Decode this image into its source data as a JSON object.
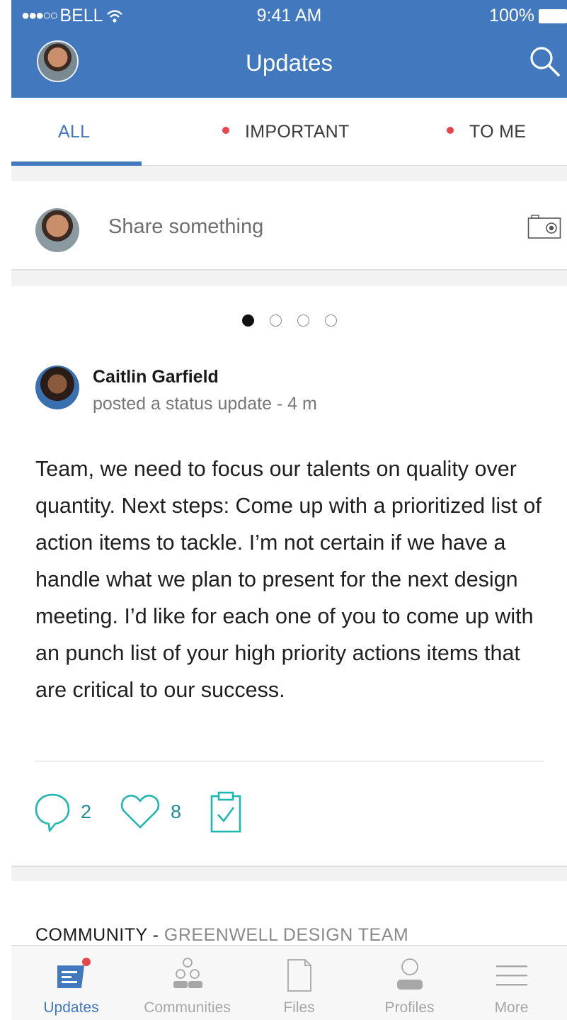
{
  "status_bar": {
    "signal": "●●●○○",
    "carrier": "BELL",
    "time": "9:41 AM",
    "battery": "100%"
  },
  "header": {
    "title": "Updates",
    "avatar_icon": "user-avatar",
    "search_icon": "search-icon",
    "background": "#4178be"
  },
  "tabs": [
    {
      "label": "ALL",
      "active": true,
      "unread_dot": false
    },
    {
      "label": "IMPORTANT",
      "active": false,
      "unread_dot": true
    },
    {
      "label": "TO ME",
      "active": false,
      "unread_dot": true
    }
  ],
  "share": {
    "placeholder": "Share something",
    "camera_icon": "camera-icon"
  },
  "carousel": {
    "pages": 4,
    "current": 1
  },
  "post": {
    "author": "Caitlin Garfield",
    "meta": "posted a status update - 4 m",
    "body": "Team, we need to focus our talents  on quality over quantity. Next steps: Come up with a prioritized list of action items to tackle. I’m not certain if we have a handle what we plan to present for the next design meeting. I’d like for each one of you to come up with an punch list of your high priority actions items that are critical to our success.",
    "comments_count": "2",
    "likes_count": "8",
    "accent": "#1fb7b0"
  },
  "community": {
    "label": "COMMUNITY",
    "separator": " - ",
    "name": "GREENWELL DESIGN TEAM"
  },
  "bottom_nav": [
    {
      "label": "Updates",
      "icon": "updates-icon",
      "active": true,
      "badge": true
    },
    {
      "label": "Communities",
      "icon": "communities-icon",
      "active": false,
      "badge": false
    },
    {
      "label": "Files",
      "icon": "files-icon",
      "active": false,
      "badge": false
    },
    {
      "label": "Profiles",
      "icon": "profiles-icon",
      "active": false,
      "badge": false
    },
    {
      "label": "More",
      "icon": "menu-icon",
      "active": false,
      "badge": false
    }
  ]
}
